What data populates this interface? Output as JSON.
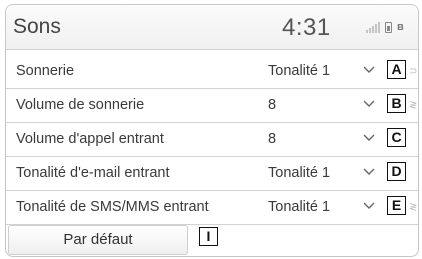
{
  "header": {
    "title": "Sons",
    "time": "4:31",
    "status_icons": [
      "signal-icon",
      "battery-icon",
      "bluetooth-icon"
    ]
  },
  "rows": [
    {
      "label": "Sonnerie",
      "value": "Tonalité 1",
      "callout": "A"
    },
    {
      "label": "Volume de sonnerie",
      "value": "8",
      "callout": "B"
    },
    {
      "label": "Volume d'appel entrant",
      "value": "8",
      "callout": "C"
    },
    {
      "label": "Tonalité d'e-mail entrant",
      "value": "Tonalité 1",
      "callout": "D"
    },
    {
      "label": "Tonalité de SMS/MMS entrant",
      "value": "Tonalité 1",
      "callout": "E"
    }
  ],
  "footer": {
    "default_button_label": "Par défaut",
    "callout": "I"
  }
}
